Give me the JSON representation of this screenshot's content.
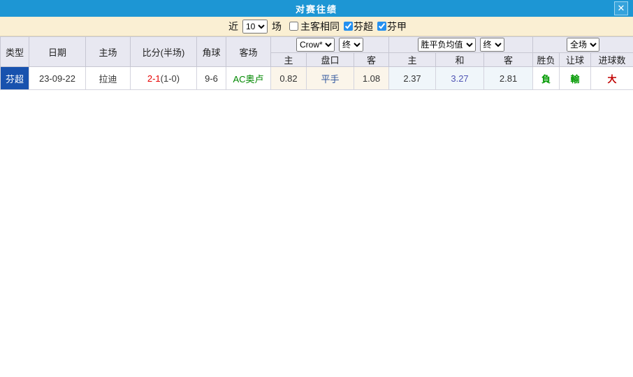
{
  "window": {
    "title": "对赛往绩",
    "close_glyph": "✕"
  },
  "filter": {
    "recent_label": "近",
    "recent_value": "10",
    "matches_label": "场",
    "same_homeaway_label": "主客相同",
    "league_a_label": "芬超",
    "league_b_label": "芬甲"
  },
  "table": {
    "columns": {
      "type": "类型",
      "date": "日期",
      "home": "主场",
      "score": "比分(半场)",
      "corners": "角球",
      "away": "客场"
    },
    "handicap_group": {
      "company_select": "Crow*",
      "time_select": "终",
      "sub_home": "主",
      "sub_line": "盘口",
      "sub_away": "客"
    },
    "odds_group": {
      "metric_select": "胜平负均值",
      "time_select": "终",
      "sub_home": "主",
      "sub_draw": "和",
      "sub_away": "客"
    },
    "result_group": {
      "scope_select": "全场",
      "sub_winloss": "胜负",
      "sub_handicap": "让球",
      "sub_goals": "进球数"
    },
    "rows": [
      {
        "league": "芬超",
        "date": "23-09-22",
        "home": "拉迪",
        "score": "2-1",
        "half": "(1-0)",
        "corners": "9-6",
        "away": "AC奥卢",
        "ah_home": "0.82",
        "ah_line": "平手",
        "ah_away": "1.08",
        "odds_home": "2.37",
        "odds_draw": "3.27",
        "odds_away": "2.81",
        "res_winloss": "負",
        "res_handicap": "輸",
        "res_goals": "大"
      }
    ]
  },
  "colors": {
    "titlebar": "#1D96D4",
    "filter_bg": "#FAEFD3",
    "header_bg": "#E8E8F1",
    "league_cell_bg": "#1852AE",
    "score_red": "#E60000",
    "away_team_green": "#008800",
    "result_green": "#009900",
    "result_red": "#C00000",
    "handicap_line_blue": "#33589E",
    "odds_draw_blue": "#5055B5",
    "handicap_cell_bg": "#FBF5EA",
    "odds_cell_bg": "#F0F6FA"
  }
}
